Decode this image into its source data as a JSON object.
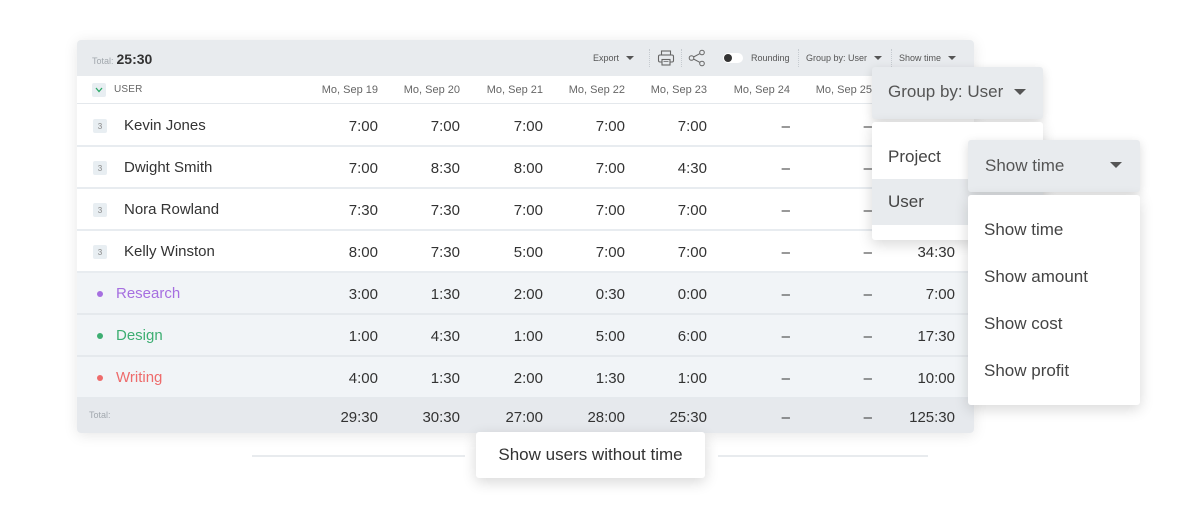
{
  "toolbar": {
    "total_label": "Total:",
    "total_value": "25:30",
    "export_label": "Export",
    "print_icon": "printer-icon",
    "share_icon": "share-icon",
    "rounding_label": "Rounding",
    "rounding_enabled": false,
    "group_by_label": "Group by: User",
    "show_label": "Show time"
  },
  "table": {
    "group_header": "USER",
    "columns": [
      "Mo, Sep 19",
      "Mo, Sep 20",
      "Mo, Sep 21",
      "Mo, Sep 22",
      "Mo, Sep 23",
      "Mo, Sep 24",
      "Mo, Sep 25"
    ],
    "users": [
      {
        "badge": "3",
        "name": "Kevin Jones",
        "values": [
          "7:00",
          "7:00",
          "7:00",
          "7:00",
          "7:00",
          "–",
          "–"
        ],
        "total": ""
      },
      {
        "badge": "3",
        "name": "Dwight Smith",
        "values": [
          "7:00",
          "8:30",
          "8:00",
          "7:00",
          "4:30",
          "–",
          "–"
        ],
        "total": ""
      },
      {
        "badge": "3",
        "name": "Nora Rowland",
        "values": [
          "7:30",
          "7:30",
          "7:00",
          "7:00",
          "7:00",
          "–",
          "–"
        ],
        "total": ""
      },
      {
        "badge": "3",
        "name": "Kelly Winston",
        "values": [
          "8:00",
          "7:30",
          "5:00",
          "7:00",
          "7:00",
          "–",
          "–"
        ],
        "total": "34:30"
      }
    ],
    "projects": [
      {
        "name": "Research",
        "color": "#a66fe0",
        "values": [
          "3:00",
          "1:30",
          "2:00",
          "0:30",
          "0:00",
          "–",
          "–"
        ],
        "total": "7:00"
      },
      {
        "name": "Design",
        "color": "#3dae72",
        "values": [
          "1:00",
          "4:30",
          "1:00",
          "5:00",
          "6:00",
          "–",
          "–"
        ],
        "total": "17:30"
      },
      {
        "name": "Writing",
        "color": "#ee6b6b",
        "values": [
          "4:00",
          "1:30",
          "2:00",
          "1:30",
          "1:00",
          "–",
          "–"
        ],
        "total": "10:00"
      }
    ],
    "totals": {
      "label": "Total:",
      "values": [
        "29:30",
        "30:30",
        "27:00",
        "28:00",
        "25:30",
        "–",
        "–"
      ],
      "total": "125:30"
    }
  },
  "group_by_dropdown": {
    "label": "Group by: User",
    "options": [
      {
        "label": "Project",
        "selected": false
      },
      {
        "label": "User",
        "selected": true
      }
    ]
  },
  "show_dropdown": {
    "label": "Show time",
    "options": [
      {
        "label": "Show time"
      },
      {
        "label": "Show amount"
      },
      {
        "label": "Show cost"
      },
      {
        "label": "Show profit"
      }
    ]
  },
  "footer": {
    "show_users_without_time_label": "Show users without time"
  }
}
